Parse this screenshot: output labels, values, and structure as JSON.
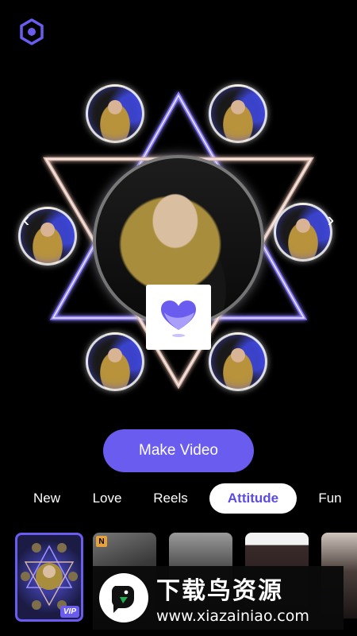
{
  "toolbar": {
    "settings_icon": "hexagon-settings-icon"
  },
  "preview": {
    "prev_icon": "chevron-left-icon",
    "next_icon": "chevron-right-icon",
    "prev_glyph": "‹",
    "next_glyph": "›",
    "logo_icon": "heart-app-logo-icon"
  },
  "actions": {
    "make_video_label": "Make Video"
  },
  "tabs": [
    {
      "label": "New"
    },
    {
      "label": "Love"
    },
    {
      "label": "Reels"
    },
    {
      "label": "Attitude",
      "active": true
    },
    {
      "label": "Fun"
    }
  ],
  "templates": [
    {
      "badge": "VIP",
      "selected": true
    },
    {
      "badge": "N"
    },
    {
      "badge": ""
    },
    {
      "badge": ""
    },
    {
      "badge": ""
    }
  ],
  "watermark": {
    "title": "下载鸟资源",
    "url": "www.xiazainiao.com"
  },
  "colors": {
    "accent": "#6b5cf0",
    "background": "#000000",
    "active_tab_text": "#5b4be3"
  }
}
